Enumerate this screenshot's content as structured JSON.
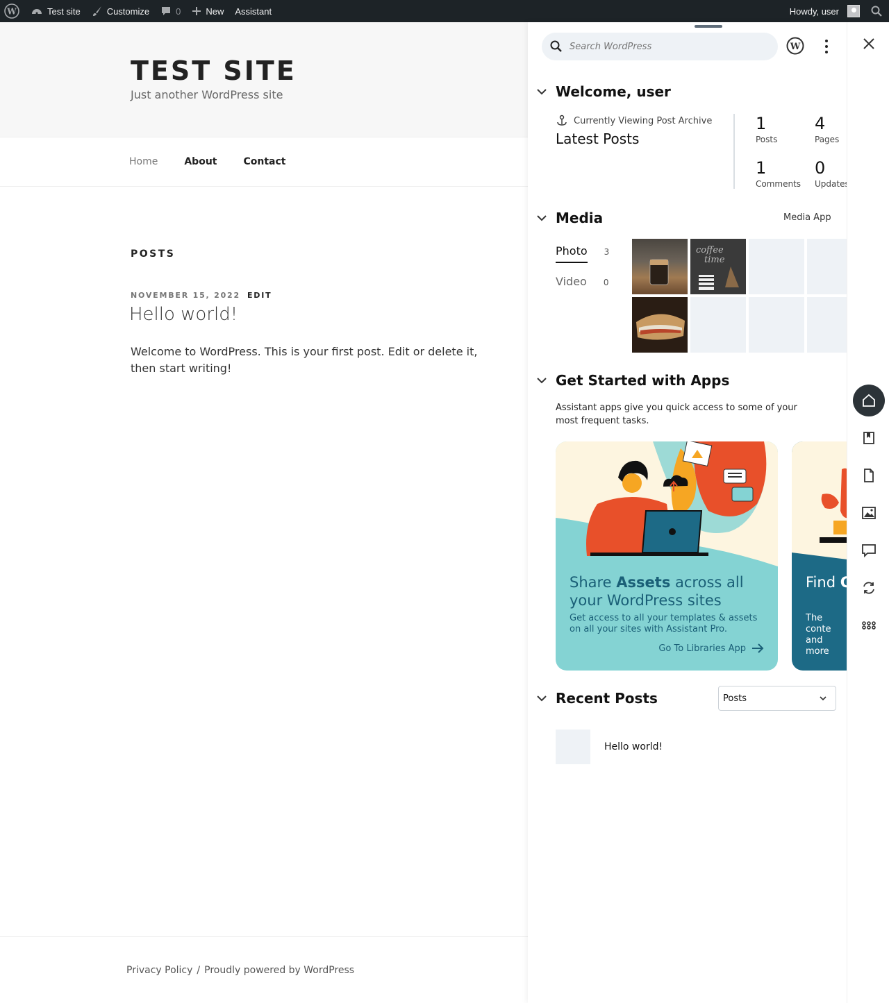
{
  "adminbar": {
    "site": "Test site",
    "customize": "Customize",
    "comments_count": "0",
    "new": "New",
    "assistant": "Assistant",
    "howdy": "Howdy, user"
  },
  "site": {
    "title": "TEST SITE",
    "tagline": "Just another WordPress site",
    "nav": [
      "Home",
      "About",
      "Contact"
    ],
    "posts_heading": "POSTS",
    "post": {
      "date": "NOVEMBER 15, 2022",
      "edit": "EDIT",
      "title": "Hello world!",
      "body": "Welcome to WordPress. This is your first post. Edit or delete it, then start writing!"
    },
    "footer": {
      "privacy": "Privacy Policy",
      "sep": "/",
      "powered": "Proudly powered by WordPress"
    }
  },
  "panel": {
    "search_placeholder": "Search WordPress",
    "welcome": {
      "heading": "Welcome, user",
      "viewing": "Currently Viewing Post Archive",
      "title": "Latest Posts",
      "stats": [
        {
          "num": "1",
          "label": "Posts"
        },
        {
          "num": "4",
          "label": "Pages"
        },
        {
          "num": "1",
          "label": "Comments"
        },
        {
          "num": "0",
          "label": "Updates"
        }
      ]
    },
    "media": {
      "heading": "Media",
      "app_link": "Media App",
      "tabs": [
        {
          "label": "Photo",
          "count": "3"
        },
        {
          "label": "Video",
          "count": "0"
        }
      ]
    },
    "apps": {
      "heading": "Get Started with Apps",
      "description": "Assistant apps give you quick access to some of your most frequent tasks.",
      "card1": {
        "title_pre": "Share ",
        "title_bold": "Assets",
        "title_post": " across all your WordPress sites",
        "desc": "Get access to all your templates & assets on all your sites with Assistant Pro.",
        "link": "Go To Libraries App"
      },
      "card2": {
        "title_pre": "Find ",
        "title_bold": "C",
        "desc": "The conte and more"
      }
    },
    "recent": {
      "heading": "Recent Posts",
      "select_value": "Posts",
      "items": [
        "Hello world!"
      ]
    }
  },
  "colors": {
    "adminbar": "#1d2327",
    "card1": "#84d3d3",
    "card2": "#1d6a86",
    "accent_text": "#1a5f77"
  }
}
